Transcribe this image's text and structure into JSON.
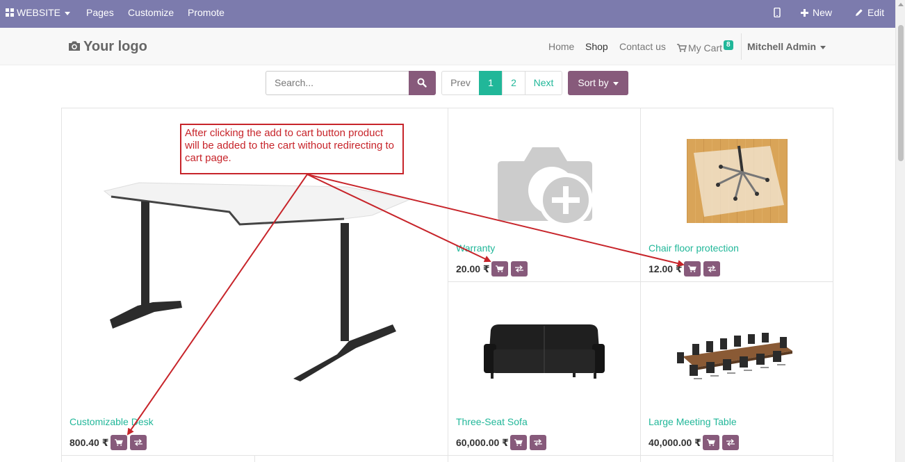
{
  "admin_bar": {
    "website_menu": "WEBSITE",
    "pages": "Pages",
    "customize": "Customize",
    "promote": "Promote",
    "new": "New",
    "edit": "Edit",
    "color": "#7c7bad"
  },
  "header": {
    "logo": "Your logo",
    "nav": {
      "home": "Home",
      "shop": "Shop",
      "contact": "Contact us",
      "cart": "My Cart",
      "cart_count": "8"
    },
    "user": "Mitchell Admin"
  },
  "toolbar": {
    "search_placeholder": "Search...",
    "pager": {
      "prev": "Prev",
      "page1": "1",
      "page2": "2",
      "next": "Next"
    },
    "sort": "Sort by"
  },
  "products": [
    {
      "name": "Customizable Desk",
      "price": "800.40 ₹"
    },
    {
      "name": "Warranty",
      "price": "20.00 ₹"
    },
    {
      "name": "Chair floor protection",
      "price": "12.00 ₹"
    },
    {
      "name": "Three-Seat Sofa",
      "price": "60,000.00 ₹"
    },
    {
      "name": "Large Meeting Table",
      "price": "40,000.00 ₹"
    }
  ],
  "annotation": "After clicking  the add to cart button product will be added to the cart without redirecting to cart page.",
  "colors": {
    "primary": "#875a7b",
    "accent": "#21b799",
    "annotation": "#c7242a"
  },
  "icons": [
    "apps-grid-icon",
    "mobile-icon",
    "plus-icon",
    "pencil-icon",
    "camera-icon",
    "cart-icon",
    "search-icon",
    "compare-icon",
    "camera-plus-icon"
  ]
}
